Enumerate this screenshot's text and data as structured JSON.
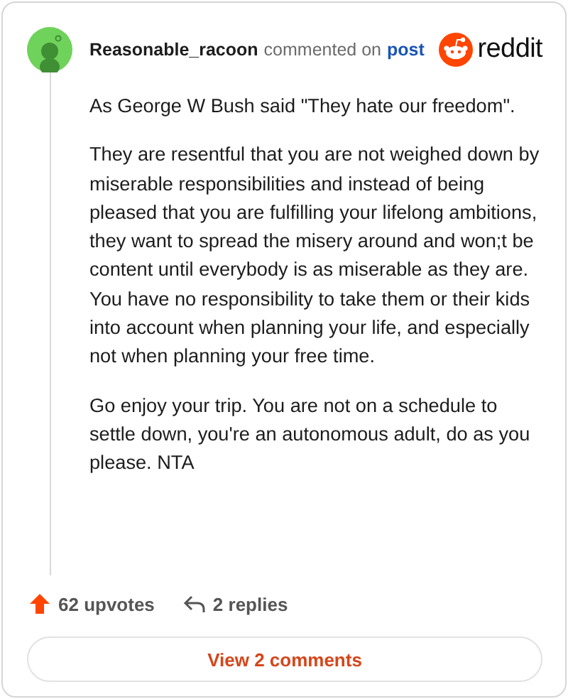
{
  "header": {
    "author": "Reasonable_racoon",
    "action": "commented on",
    "link": "post",
    "brand": "reddit"
  },
  "comment": {
    "paragraphs": [
      "As George W Bush said \"They hate our freedom\".",
      "They are resentful that you are not weighed down by miserable responsibilities and instead of being pleased that you are fulfilling your lifelong ambitions, they want to spread the misery around and won;t be content until everybody is as miserable as they are. You have no responsibility to take them or their kids into account when planning your life, and especially not when planning your free time.",
      "Go enjoy your trip. You are not on a schedule to settle down, you're an autonomous adult, do as you please. NTA"
    ]
  },
  "footer": {
    "upvotes": "62 upvotes",
    "replies": "2 replies"
  },
  "button": "View 2 comments"
}
